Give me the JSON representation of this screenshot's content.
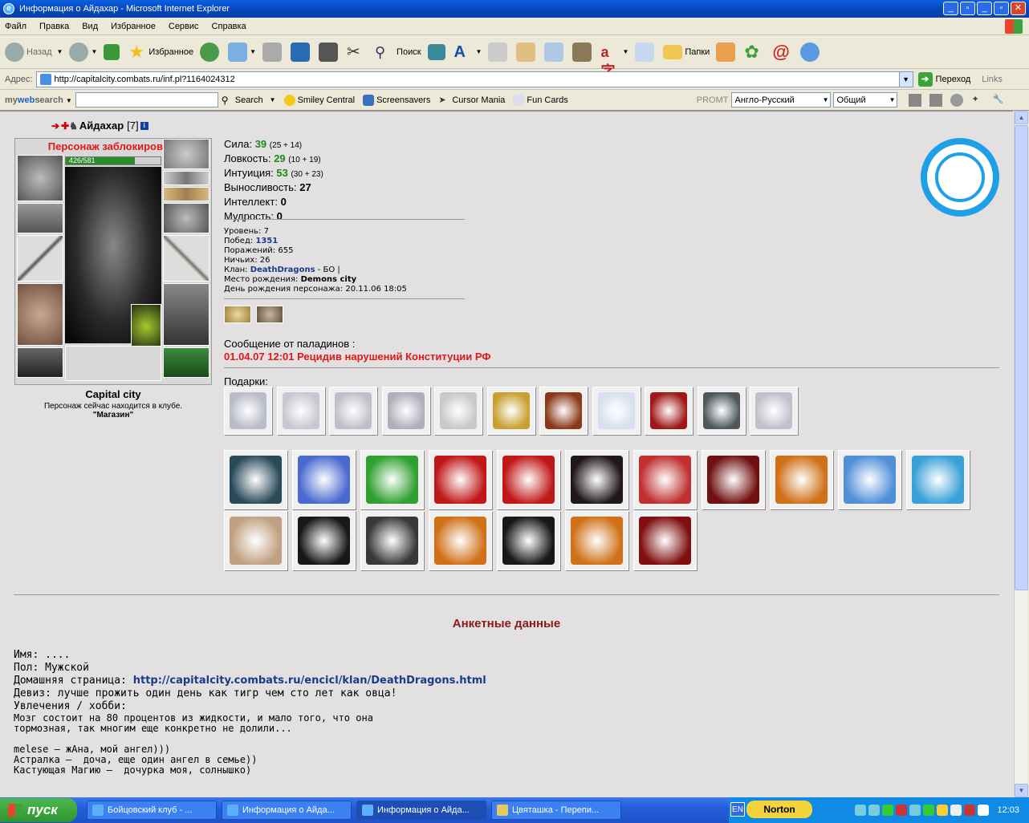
{
  "window": {
    "title": "Информация о Айдахар - Microsoft Internet Explorer"
  },
  "menu": [
    "Файл",
    "Правка",
    "Вид",
    "Избранное",
    "Сервис",
    "Справка"
  ],
  "toolbar": {
    "back": "Назад",
    "favorites": "Избранное",
    "search": "Поиск",
    "folders": "Папки"
  },
  "address": {
    "label": "Адрес:",
    "url": "http://capitalcity.combats.ru/inf.pl?1164024312",
    "go": "Переход",
    "links": "Links"
  },
  "searchbar": {
    "brand_my": "my",
    "brand_web": "web",
    "brand_search": "search",
    "search_btn": "Search",
    "smiley": "Smiley Central",
    "screensavers": "Screensavers",
    "cursor": "Cursor Mania",
    "funcards": "Fun Cards",
    "promt": "PROMT",
    "lang_select": "Англо-Русский",
    "type_select": "Общий"
  },
  "character": {
    "name": "Айдахар",
    "level": "[7]",
    "blocked": "Персонаж заблокирован!",
    "hp": "426/581",
    "hp_fraction": 0.733,
    "city": "Capital city",
    "location_text": "Персонаж сейчас находится в клубе.",
    "location_name": "\"Магазин\""
  },
  "stats": [
    {
      "label": "Сила:",
      "value": "39",
      "extra": "(25 + 14)"
    },
    {
      "label": "Ловкость:",
      "value": "29",
      "extra": "(10 + 19)"
    },
    {
      "label": "Интуиция:",
      "value": "53",
      "extra": "(30 + 23)"
    },
    {
      "label": "Выносливость:",
      "value": "27",
      "extra": ""
    },
    {
      "label": "Интеллект:",
      "value": "0",
      "extra": ""
    },
    {
      "label": "Мудрость:",
      "value": "0",
      "extra": ""
    }
  ],
  "details": {
    "level": "Уровень: 7",
    "wins_label": "Побед:",
    "wins": "1351",
    "losses": "Поражений: 655",
    "draws": "Ничьих: 26",
    "clan_label": "Клан:",
    "clan": "DeathDragons",
    "clan_extra": " - БО |",
    "birthplace_label": "Место рождения:",
    "birthplace": "Demons city",
    "birthday": "День рождения персонажа: 20.11.06 18:05"
  },
  "message": {
    "label": "Сообщение от паладинов :",
    "text": "01.04.07 12:01 Рецидив нарушений Конституции РФ"
  },
  "gifts_label": "Подарки:",
  "gift_colors_row1": [
    "#b8bcc8",
    "#c8c8d0",
    "#c0c0c8",
    "#b0b0bc",
    "#c8c8cc",
    "#c8a030",
    "#8a3a1a",
    "#d8e0f0",
    "#a01818",
    "#50585c",
    "#c0c0cc"
  ],
  "gift_colors_row2": [
    "#2a4a5a",
    "#4a6ad0",
    "#30a030",
    "#c01818",
    "#c01818",
    "#201818",
    "#c03030",
    "#701010",
    "#d07018",
    "#5090d8",
    "#3aa0d8"
  ],
  "gift_colors_row3": [
    "#c0a080",
    "#181818",
    "#383838",
    "#d07018",
    "#181818",
    "#d07018",
    "#801010"
  ],
  "anket": {
    "title": "Анкетные данные",
    "name": "Имя: ....",
    "gender": "Пол: Мужской",
    "homepage_label": "Домашняя страница: ",
    "homepage": "http://capitalcity.combats.ru/encicl/klan/DeathDragons.html",
    "motto": "Девиз: лучше прожить один день как тигр чем сто лет как овца!",
    "hobby_label": "Увлечения / хобби:",
    "hobby1": "Мозг состоит на 80 процентов из жидкости, и мало того, что она",
    "hobby2": "тормозная, так многим еще конкретно не долили...",
    "line1": "melese – жАна, мой ангел)))",
    "line2": "Астралка –  доча, еще один ангел в семье))",
    "line3": "Кастующая Магию –  дочурка моя, солнышко)"
  },
  "taskbar": {
    "start": "пуск",
    "tasks": [
      "Бойцовский клуб - ...",
      "Информация о Айда...",
      "Информация о Айда...",
      "Цвяташка - Перепи..."
    ],
    "lang": "EN",
    "norton": "Norton",
    "clock": "12:03"
  }
}
